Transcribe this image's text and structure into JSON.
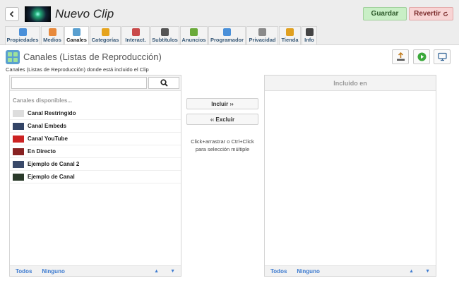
{
  "header": {
    "title": "Nuevo Clip",
    "save_label": "Guardar",
    "revert_label": "Revertir"
  },
  "tabs": [
    {
      "label": "Propiedades",
      "icon": "properties-icon",
      "color": "#4a90d9"
    },
    {
      "label": "Medios",
      "icon": "media-icon",
      "color": "#e88a3c"
    },
    {
      "label": "Canales",
      "icon": "channels-icon",
      "color": "#5aa0d0",
      "active": true
    },
    {
      "label": "Categorías",
      "icon": "folder-icon",
      "color": "#e6a41e"
    },
    {
      "label": "Interact.",
      "icon": "cursor-icon",
      "color": "#c94a4a"
    },
    {
      "label": "Subtítulos",
      "icon": "subtitles-icon",
      "color": "#555555"
    },
    {
      "label": "Anuncios",
      "icon": "ads-icon",
      "color": "#6aaa3a"
    },
    {
      "label": "Programador",
      "icon": "scheduler-icon",
      "color": "#4a90d9"
    },
    {
      "label": "Privacidad",
      "icon": "privacy-icon",
      "color": "#8a8a8a"
    },
    {
      "label": "Tienda",
      "icon": "store-icon",
      "color": "#e0a020"
    },
    {
      "label": "Info",
      "icon": "info-icon",
      "color": "#444444"
    }
  ],
  "section": {
    "title": "Canales (Listas de Reproducción)",
    "subtitle": "Canales (Listas de Reproducción) donde está incluido el Clip"
  },
  "left_list": {
    "search_placeholder": "",
    "heading": "Canales disponibles...",
    "items": [
      {
        "label": "Canal Restringido",
        "icon": "restricted-channel-icon",
        "color": "#cccccc"
      },
      {
        "label": "Canal Embeds",
        "icon": "embeds-channel-icon",
        "color": "#334466"
      },
      {
        "label": "Canal YouTube",
        "icon": "youtube-channel-icon",
        "color": "#cc2222"
      },
      {
        "label": "En Directo",
        "icon": "live-channel-icon",
        "color": "#882222"
      },
      {
        "label": "Ejemplo de Canal 2",
        "icon": "channel-thumb-icon",
        "color": "#3a4a6a"
      },
      {
        "label": "Ejemplo de Canal",
        "icon": "channel-thumb-icon",
        "color": "#2a3a2a"
      }
    ],
    "footer": {
      "all": "Todos",
      "none": "Ninguno"
    }
  },
  "middle": {
    "include": "Incluir ››",
    "exclude": "‹‹ Excluir",
    "hint": "Click+arrastrar o Ctrl+Click para selección múltiple"
  },
  "right_list": {
    "heading": "Incluido en",
    "footer": {
      "all": "Todos",
      "none": "Ninguno"
    }
  }
}
